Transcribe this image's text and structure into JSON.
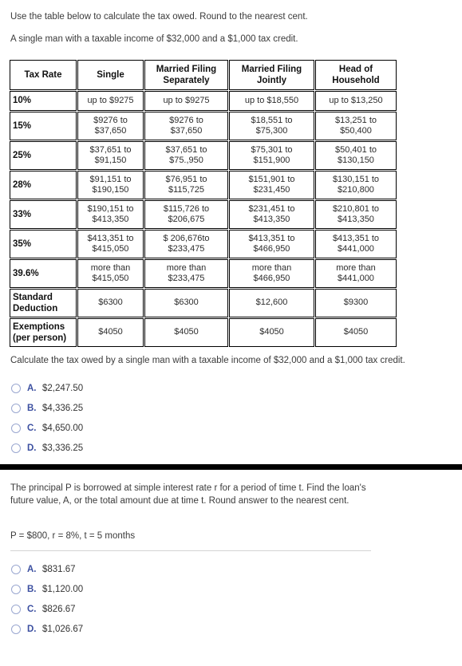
{
  "question1": {
    "intro_line_1": "Use the table below to calculate the tax owed.  Round to the nearest cent.",
    "intro_line_2": "A single man with a taxable income of $32,000 and a $1,000 tax credit.",
    "prompt": "Calculate the tax owed by a single man with a taxable income of $32,000 and a $1,000 tax credit.",
    "choices": [
      {
        "letter": "A.",
        "value": "$2,247.50"
      },
      {
        "letter": "B.",
        "value": "$4,336.25"
      },
      {
        "letter": "C.",
        "value": "$4,650.00"
      },
      {
        "letter": "D.",
        "value": "$3,336.25"
      }
    ]
  },
  "tax_table": {
    "headers": [
      {
        "line1": "Tax Rate",
        "line2": ""
      },
      {
        "line1": "Single",
        "line2": ""
      },
      {
        "line1": "Married Filing",
        "line2": "Separately"
      },
      {
        "line1": "Married Filing",
        "line2": "Jointly"
      },
      {
        "line1": "Head of",
        "line2": "Household"
      }
    ],
    "rows": [
      {
        "type": "single",
        "rate": "10%",
        "cells": [
          {
            "line1": "up to $9275",
            "line2": ""
          },
          {
            "line1": "up to $9275",
            "line2": ""
          },
          {
            "line1": "up to $18,550",
            "line2": ""
          },
          {
            "line1": "up to $13,250",
            "line2": ""
          }
        ]
      },
      {
        "type": "double",
        "rate": "15%",
        "cells": [
          {
            "line1": "$9276 to",
            "line2": "$37,650"
          },
          {
            "line1": "$9276 to",
            "line2": "$37,650"
          },
          {
            "line1": "$18,551 to",
            "line2": "$75,300"
          },
          {
            "line1": "$13,251 to",
            "line2": "$50,400"
          }
        ]
      },
      {
        "type": "double",
        "rate": "25%",
        "cells": [
          {
            "line1": "$37,651 to",
            "line2": "$91,150"
          },
          {
            "line1": "$37,651 to",
            "line2": "$75.,950"
          },
          {
            "line1": "$75,301 to",
            "line2": "$151,900"
          },
          {
            "line1": "$50,401 to",
            "line2": "$130,150"
          }
        ]
      },
      {
        "type": "double",
        "rate": "28%",
        "cells": [
          {
            "line1": "$91,151 to",
            "line2": "$190,150"
          },
          {
            "line1": "$76,951 to",
            "line2": "$115,725"
          },
          {
            "line1": "$151,901 to",
            "line2": "$231,450"
          },
          {
            "line1": "$130,151 to",
            "line2": "$210,800"
          }
        ]
      },
      {
        "type": "double",
        "rate": "33%",
        "cells": [
          {
            "line1": "$190,151 to",
            "line2": "$413,350"
          },
          {
            "line1": "$115,726 to",
            "line2": "$206,675"
          },
          {
            "line1": "$231,451 to",
            "line2": "$413,350"
          },
          {
            "line1": "$210,801 to",
            "line2": "$413,350"
          }
        ]
      },
      {
        "type": "double",
        "rate": "35%",
        "cells": [
          {
            "line1": "$413,351 to",
            "line2": "$415,050"
          },
          {
            "line1": "$ 206,676to",
            "line2": "$233,475"
          },
          {
            "line1": "$413,351 to",
            "line2": "$466,950"
          },
          {
            "line1": "$413,351 to",
            "line2": "$441,000"
          }
        ]
      },
      {
        "type": "double",
        "rate": "39.6%",
        "cells": [
          {
            "line1": "more than",
            "line2": "$415,050"
          },
          {
            "line1": "more than",
            "line2": "$233,475"
          },
          {
            "line1": "more than",
            "line2": "$466,950"
          },
          {
            "line1": "more than",
            "line2": "$441,000"
          }
        ]
      },
      {
        "type": "deduction",
        "rate_line1": "Standard",
        "rate_line2": "Deduction",
        "cells": [
          {
            "line1": "$6300",
            "line2": ""
          },
          {
            "line1": "$6300",
            "line2": ""
          },
          {
            "line1": "$12,600",
            "line2": ""
          },
          {
            "line1": "$9300",
            "line2": ""
          }
        ]
      },
      {
        "type": "exemptions",
        "rate_line1": "Exemptions",
        "rate_line2": "(per person)",
        "cells": [
          {
            "line1": "$4050",
            "line2": ""
          },
          {
            "line1": "$4050",
            "line2": ""
          },
          {
            "line1": "$4050",
            "line2": ""
          },
          {
            "line1": "$4050",
            "line2": ""
          }
        ]
      }
    ]
  },
  "question2": {
    "stem": "The principal P is borrowed at simple interest rate r for a period of time t. Find the loan's future value, A, or the total amount due at time t. Round answer to the nearest cent.",
    "given": "P = $800, r = 8%, t = 5 months",
    "choices": [
      {
        "letter": "A.",
        "value": "$831.67"
      },
      {
        "letter": "B.",
        "value": "$1,120.00"
      },
      {
        "letter": "C.",
        "value": "$826.67"
      },
      {
        "letter": "D.",
        "value": "$1,026.67"
      }
    ]
  },
  "colors": {
    "text": "#3b3b3b",
    "choice_letter": "#3b4fa0",
    "radio_border": "#9aa7d0",
    "table_border": "#000000",
    "separator": "#000000",
    "rule": "#d4d4d4"
  }
}
